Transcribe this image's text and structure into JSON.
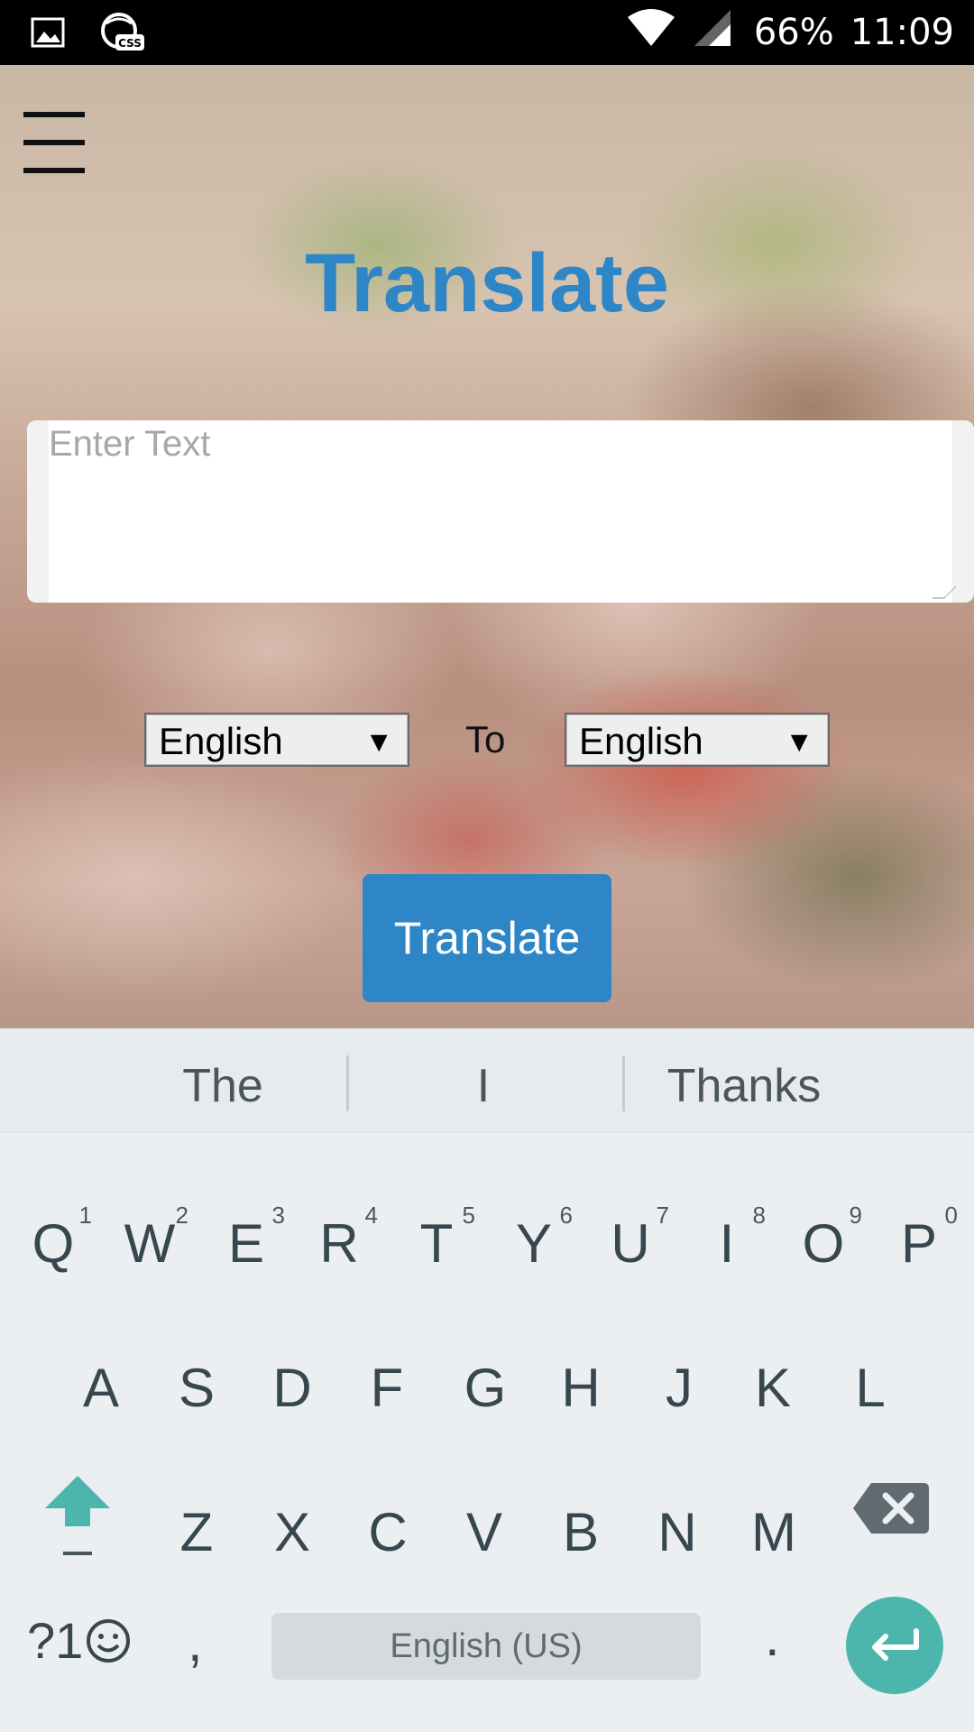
{
  "status_bar": {
    "battery_pct": "66%",
    "time": "11:09",
    "left_icons": [
      "gallery-icon",
      "css-app-icon"
    ],
    "right_icons": [
      "wifi-icon",
      "cell-signal-icon"
    ]
  },
  "app": {
    "menu_icon": "hamburger-menu-icon",
    "title": "Translate",
    "input": {
      "placeholder": "Enter Text",
      "value": ""
    },
    "from_language": "English",
    "to_label": "To",
    "to_language": "English",
    "translate_button": "Translate"
  },
  "keyboard": {
    "suggestions": [
      "The",
      "I",
      "Thanks"
    ],
    "row1": [
      {
        "key": "Q",
        "hint": "1"
      },
      {
        "key": "W",
        "hint": "2"
      },
      {
        "key": "E",
        "hint": "3"
      },
      {
        "key": "R",
        "hint": "4"
      },
      {
        "key": "T",
        "hint": "5"
      },
      {
        "key": "Y",
        "hint": "6"
      },
      {
        "key": "U",
        "hint": "7"
      },
      {
        "key": "I",
        "hint": "8"
      },
      {
        "key": "O",
        "hint": "9"
      },
      {
        "key": "P",
        "hint": "0"
      }
    ],
    "row2": [
      "A",
      "S",
      "D",
      "F",
      "G",
      "H",
      "J",
      "K",
      "L"
    ],
    "row3": [
      "Z",
      "X",
      "C",
      "V",
      "B",
      "N",
      "M"
    ],
    "symbols_label": "?1",
    "comma": ",",
    "period": ".",
    "space_label": "English (US)",
    "accent_color": "#4db6ac"
  },
  "colors": {
    "brand_blue": "#2f86c6",
    "keyboard_bg": "#eceff1",
    "key_text": "#37474f"
  }
}
